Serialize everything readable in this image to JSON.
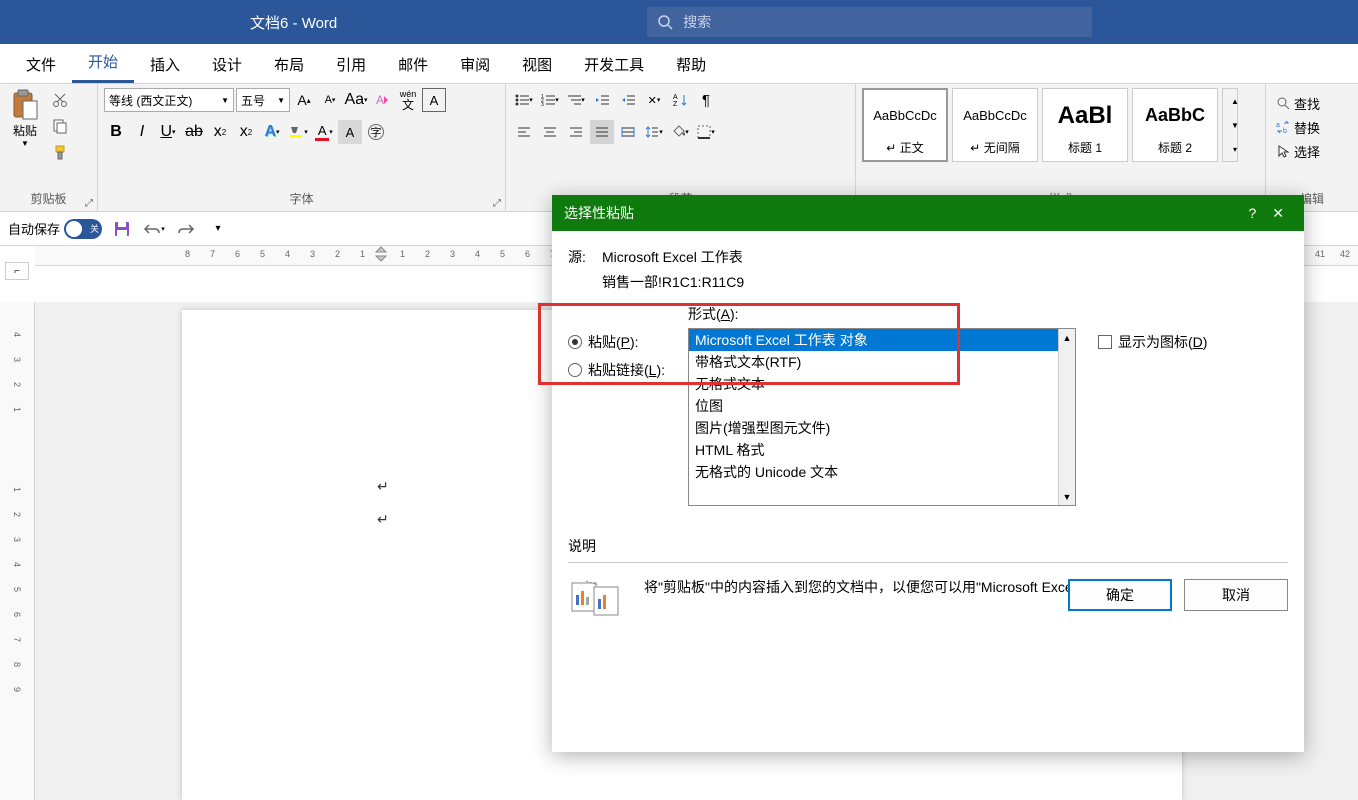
{
  "titlebar": {
    "doc_title": "文档6",
    "app": "Word",
    "search_placeholder": "搜索"
  },
  "tabs": {
    "file": "文件",
    "home": "开始",
    "insert": "插入",
    "design": "设计",
    "layout": "布局",
    "references": "引用",
    "mailings": "邮件",
    "review": "审阅",
    "view": "视图",
    "developer": "开发工具",
    "help": "帮助"
  },
  "ribbon": {
    "clipboard": {
      "label": "剪贴板",
      "paste": "粘贴"
    },
    "font": {
      "label": "字体",
      "name": "等线 (西文正文)",
      "size": "五号"
    },
    "paragraph": {
      "label": "段落"
    },
    "styles": {
      "label": "样式",
      "items": [
        {
          "name": "正文",
          "preview": "AaBbCcDc",
          "prefix": "↵"
        },
        {
          "name": "无间隔",
          "preview": "AaBbCcDc",
          "prefix": "↵"
        },
        {
          "name": "标题 1",
          "preview": "AaBl",
          "prefix": ""
        },
        {
          "name": "标题 2",
          "preview": "AaBbC",
          "prefix": ""
        }
      ]
    },
    "editing": {
      "label": "编辑",
      "find": "查找",
      "replace": "替换",
      "select": "选择"
    }
  },
  "qat": {
    "autosave_label": "自动保存",
    "autosave_off": "关"
  },
  "dialog": {
    "title": "选择性粘贴",
    "source_label": "源:",
    "source_value": "Microsoft Excel 工作表",
    "source_range": "销售一部!R1C1:R11C9",
    "format_label_pre": "形式(",
    "format_label_key": "A",
    "format_label_post": "):",
    "paste_label_pre": "粘贴(",
    "paste_label_key": "P",
    "paste_label_post": "):",
    "pastelink_label_pre": "粘贴链接(",
    "pastelink_label_key": "L",
    "pastelink_label_post": "):",
    "display_icon_pre": "显示为图标(",
    "display_icon_key": "D",
    "display_icon_post": ")",
    "formats": [
      "Microsoft Excel 工作表 对象",
      "带格式文本(RTF)",
      "无格式文本",
      "位图",
      "图片(增强型图元文件)",
      "HTML 格式",
      "无格式的 Unicode 文本"
    ],
    "desc_label": "说明",
    "desc_text": "将\"剪贴板\"中的内容插入到您的文档中，以便您可以用\"Microsoft Excel 12\"来编辑它。",
    "ok": "确定",
    "cancel": "取消"
  },
  "ruler_h": [
    "8",
    "7",
    "6",
    "5",
    "4",
    "3",
    "2",
    "1",
    "1",
    "2",
    "3",
    "4",
    "5",
    "6",
    "7"
  ],
  "ruler_h2": [
    "41",
    "42"
  ],
  "ruler_v": [
    "4",
    "3",
    "2",
    "1",
    "1",
    "2",
    "3",
    "4",
    "5",
    "6",
    "7",
    "8",
    "9"
  ]
}
